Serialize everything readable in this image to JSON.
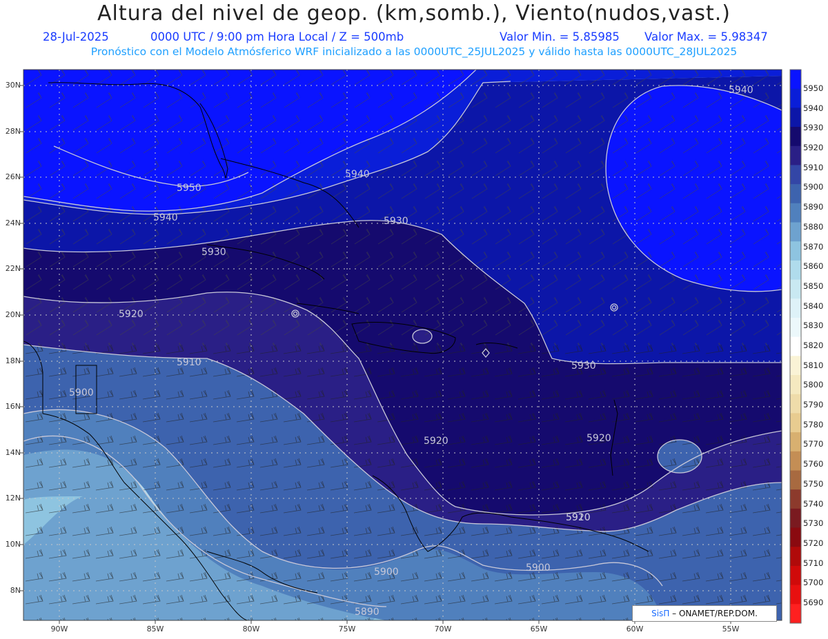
{
  "header": {
    "title": "Altura del nivel de geop. (km,somb.), Viento(nudos,vast.)",
    "date": "28-Jul-2025",
    "time": "0000 UTC / 9:00 pm Hora Local / Z = 500mb",
    "min": "Valor Min. = 5.85985",
    "max": "Valor Max. = 5.98347",
    "model_line": "Pronóstico con el Modelo Atmósferico WRF inicializado a las 0000UTC_25JUL2025 y válido hasta las  0000UTC_28JUL2025"
  },
  "lat_labels": [
    "30N",
    "28N",
    "26N",
    "24N",
    "22N",
    "20N",
    "18N",
    "16N",
    "14N",
    "12N",
    "10N",
    "8N"
  ],
  "lon_labels": [
    "90W",
    "85W",
    "80W",
    "75W",
    "70W",
    "65W",
    "60W",
    "55W"
  ],
  "colorbar": {
    "labels": [
      "5950",
      "5940",
      "5930",
      "5920",
      "5910",
      "5900",
      "5890",
      "5880",
      "5870",
      "5860",
      "5850",
      "5840",
      "5830",
      "5820",
      "5810",
      "5800",
      "5790",
      "5780",
      "5770",
      "5760",
      "5750",
      "5740",
      "5730",
      "5720",
      "5710",
      "5700",
      "5690"
    ],
    "colors": [
      "#0a14ff",
      "#0a1ed8",
      "#0c16a8",
      "#150a6e",
      "#2a1f86",
      "#3346a6",
      "#3d63ae",
      "#5080bd",
      "#6ea2cf",
      "#8ec4e0",
      "#b0dcec",
      "#c9e9f2",
      "#def2f8",
      "#ecf8fb",
      "#ffffff",
      "#faf3d6",
      "#f5e9c0",
      "#efdcaa",
      "#e8cc90",
      "#d8b070",
      "#c48e55",
      "#a86a40",
      "#8c3a2c",
      "#7a1a20",
      "#8a0a10",
      "#b00a0a",
      "#d00a0a",
      "#e81010",
      "#ff2020"
    ]
  },
  "contours": [
    "5950",
    "5940",
    "5940",
    "5940",
    "5930",
    "5930",
    "5930",
    "5920",
    "5920",
    "5920",
    "5920",
    "5910",
    "5910",
    "5900",
    "5900",
    "5900",
    "5890"
  ],
  "credit": {
    "brand": "SisΠ",
    "text": "– ONAMET/REP.DOM."
  }
}
